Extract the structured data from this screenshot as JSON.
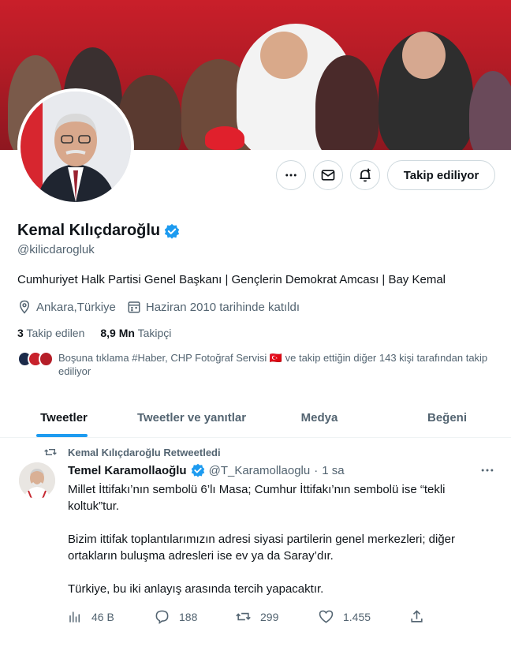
{
  "profile": {
    "name": "Kemal Kılıçdaroğlu",
    "handle": "@kilicdarogluk",
    "bio": "Cumhuriyet Halk Partisi Genel Başkanı | Gençlerin Demokrat Amcası | Bay Kemal",
    "location": "Ankara,Türkiye",
    "joined": "Haziran 2010 tarihinde katıldı",
    "following_count": "3",
    "following_label": "Takip edilen",
    "followers_count": "8,9 Mn",
    "followers_label": "Takipçi",
    "followed_by": "Boşuna tıklama #Haber, CHP Fotoğraf Servisi 🇹🇷 ve takip ettiğin diğer 143 kişi tarafından takip ediliyor"
  },
  "actions": {
    "follow_label": "Takip ediliyor"
  },
  "tabs": [
    {
      "label": "Tweetler",
      "active": true
    },
    {
      "label": "Tweetler ve yanıtlar",
      "active": false
    },
    {
      "label": "Medya",
      "active": false
    },
    {
      "label": "Beğeni",
      "active": false
    }
  ],
  "tweet": {
    "retweeted_by": "Kemal Kılıçdaroğlu Retweetledi",
    "author_name": "Temel Karamollaoğlu",
    "author_handle": "@T_Karamollaoglu",
    "separator": "·",
    "time": "1 sa",
    "paragraphs": [
      "Millet İttifakı’nın sembolü 6’lı Masa; Cumhur İttifakı’nın sembolü ise “tekli koltuk”tur.",
      "Bizim ittifak toplantılarımızın adresi siyasi partilerin genel merkezleri; diğer ortakların buluşma adresleri ise ev ya da Saray’dır.",
      "Türkiye, bu iki anlayış arasında tercih yapacaktır."
    ],
    "views": "46 B",
    "replies": "188",
    "retweets": "299",
    "likes": "1.455"
  },
  "colors": {
    "accent": "#1d9bf0",
    "verified": "#1d9bf0",
    "banner": "#c91f2a"
  },
  "icons": [
    "more-icon",
    "mail-icon",
    "notification-bell-icon",
    "verified-icon",
    "location-icon",
    "calendar-icon",
    "retweet-icon",
    "views-icon",
    "reply-icon",
    "like-icon",
    "share-icon"
  ]
}
